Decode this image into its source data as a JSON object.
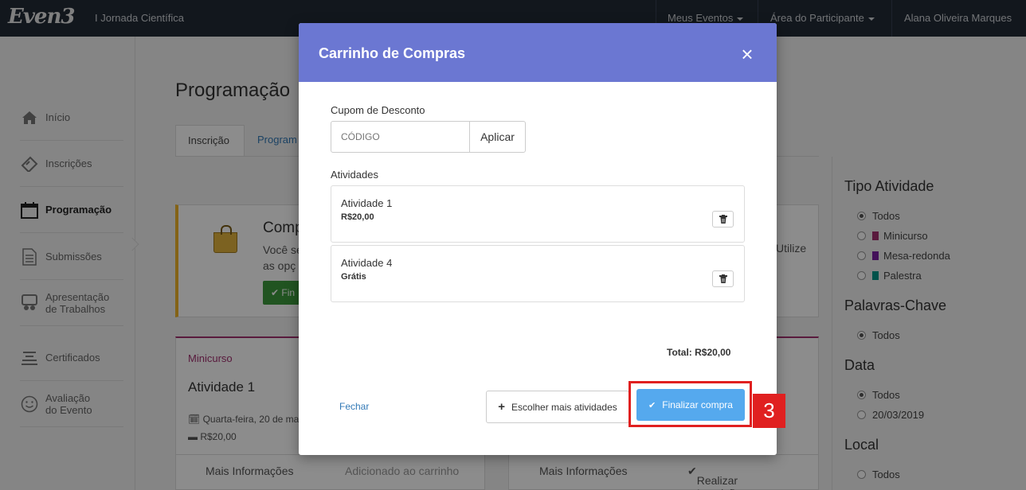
{
  "topbar": {
    "logo": "Even3",
    "event_name": "I Jornada Científica",
    "menu_events": "Meus Eventos",
    "menu_participant": "Área do Participante",
    "user_name": "Alana Oliveira Marques"
  },
  "sidebar": {
    "items": [
      {
        "label": "Início",
        "icon": "home-icon"
      },
      {
        "label": "Inscrições",
        "icon": "ticket-icon"
      },
      {
        "label": "Programação",
        "icon": "calendar-icon"
      },
      {
        "label": "Submissões",
        "icon": "document-icon"
      },
      {
        "label": "Apresentação de Trabalhos",
        "icon": "presentation-icon"
      },
      {
        "label": "Certificados",
        "icon": "certificate-icon"
      },
      {
        "label": "Avaliação do Evento",
        "icon": "smile-icon"
      }
    ]
  },
  "main": {
    "title": "Programação",
    "tabs": [
      {
        "label": "Inscrição"
      },
      {
        "label": "Program"
      }
    ],
    "info": {
      "title": "Comp",
      "text_line1": "Você se",
      "text_line2": "as opç",
      "text_right": "Utilize",
      "button": "Fin"
    },
    "cards": [
      {
        "category": "Minicurso",
        "title": "Atividade 1",
        "date": "Quarta-feira, 20 de ma",
        "price": "R$20,00",
        "more_info": "Mais Informações",
        "status": "Adicionado ao carrinho"
      },
      {
        "more_info": "Mais Informações",
        "action": "Realizar Inscrição"
      }
    ]
  },
  "filters": {
    "tipo_title": "Tipo Atividade",
    "tipo_options": [
      {
        "label": "Todos",
        "selected": true,
        "color": ""
      },
      {
        "label": "Minicurso",
        "selected": false,
        "color": "#a2306f"
      },
      {
        "label": "Mesa-redonda",
        "selected": false,
        "color": "#7b1fa2"
      },
      {
        "label": "Palestra",
        "selected": false,
        "color": "#009688"
      }
    ],
    "palavras_title": "Palavras-Chave",
    "palavras_all": "Todos",
    "data_title": "Data",
    "data_options": [
      {
        "label": "Todos",
        "selected": true
      },
      {
        "label": "20/03/2019",
        "selected": false
      }
    ],
    "local_title": "Local",
    "local_all": "Todos"
  },
  "modal": {
    "title": "Carrinho de Compras",
    "coupon_label": "Cupom de Desconto",
    "coupon_placeholder": "CÓDIGO",
    "apply_label": "Aplicar",
    "activities_label": "Atividades",
    "activities": [
      {
        "name": "Atividade 1",
        "price": "R$20,00"
      },
      {
        "name": "Atividade 4",
        "price": "Grátis"
      }
    ],
    "total": "Total: R$20,00",
    "close_link": "Fechar",
    "more_button": "Escolher mais atividades",
    "finish_button": "Finalizar compra"
  },
  "annotation": {
    "step": "3",
    "color": "#e02020"
  },
  "colors": {
    "topbar": "#222a36",
    "modal_header": "#6b77d2",
    "finish_button": "#55a9ee",
    "minicurso": "#a2306f"
  }
}
